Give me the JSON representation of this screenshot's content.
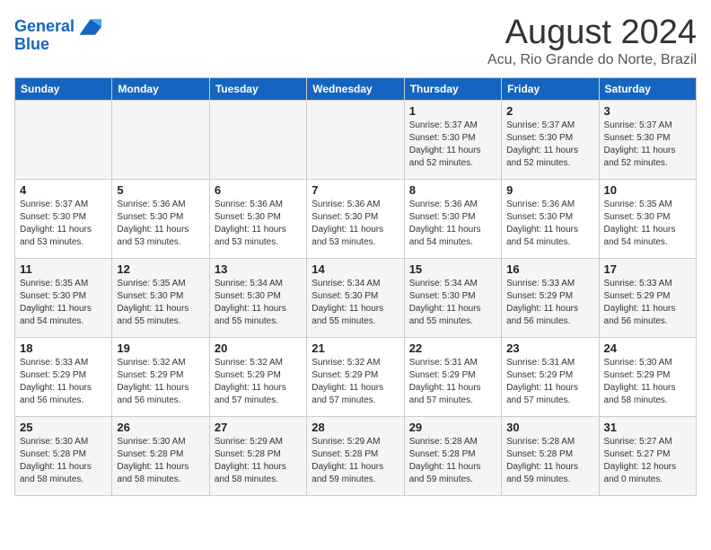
{
  "header": {
    "logo_line1": "General",
    "logo_line2": "Blue",
    "title": "August 2024",
    "subtitle": "Acu, Rio Grande do Norte, Brazil"
  },
  "days_of_week": [
    "Sunday",
    "Monday",
    "Tuesday",
    "Wednesday",
    "Thursday",
    "Friday",
    "Saturday"
  ],
  "weeks": [
    [
      {
        "day": "",
        "info": ""
      },
      {
        "day": "",
        "info": ""
      },
      {
        "day": "",
        "info": ""
      },
      {
        "day": "",
        "info": ""
      },
      {
        "day": "1",
        "info": "Sunrise: 5:37 AM\nSunset: 5:30 PM\nDaylight: 11 hours\nand 52 minutes."
      },
      {
        "day": "2",
        "info": "Sunrise: 5:37 AM\nSunset: 5:30 PM\nDaylight: 11 hours\nand 52 minutes."
      },
      {
        "day": "3",
        "info": "Sunrise: 5:37 AM\nSunset: 5:30 PM\nDaylight: 11 hours\nand 52 minutes."
      }
    ],
    [
      {
        "day": "4",
        "info": "Sunrise: 5:37 AM\nSunset: 5:30 PM\nDaylight: 11 hours\nand 53 minutes."
      },
      {
        "day": "5",
        "info": "Sunrise: 5:36 AM\nSunset: 5:30 PM\nDaylight: 11 hours\nand 53 minutes."
      },
      {
        "day": "6",
        "info": "Sunrise: 5:36 AM\nSunset: 5:30 PM\nDaylight: 11 hours\nand 53 minutes."
      },
      {
        "day": "7",
        "info": "Sunrise: 5:36 AM\nSunset: 5:30 PM\nDaylight: 11 hours\nand 53 minutes."
      },
      {
        "day": "8",
        "info": "Sunrise: 5:36 AM\nSunset: 5:30 PM\nDaylight: 11 hours\nand 54 minutes."
      },
      {
        "day": "9",
        "info": "Sunrise: 5:36 AM\nSunset: 5:30 PM\nDaylight: 11 hours\nand 54 minutes."
      },
      {
        "day": "10",
        "info": "Sunrise: 5:35 AM\nSunset: 5:30 PM\nDaylight: 11 hours\nand 54 minutes."
      }
    ],
    [
      {
        "day": "11",
        "info": "Sunrise: 5:35 AM\nSunset: 5:30 PM\nDaylight: 11 hours\nand 54 minutes."
      },
      {
        "day": "12",
        "info": "Sunrise: 5:35 AM\nSunset: 5:30 PM\nDaylight: 11 hours\nand 55 minutes."
      },
      {
        "day": "13",
        "info": "Sunrise: 5:34 AM\nSunset: 5:30 PM\nDaylight: 11 hours\nand 55 minutes."
      },
      {
        "day": "14",
        "info": "Sunrise: 5:34 AM\nSunset: 5:30 PM\nDaylight: 11 hours\nand 55 minutes."
      },
      {
        "day": "15",
        "info": "Sunrise: 5:34 AM\nSunset: 5:30 PM\nDaylight: 11 hours\nand 55 minutes."
      },
      {
        "day": "16",
        "info": "Sunrise: 5:33 AM\nSunset: 5:29 PM\nDaylight: 11 hours\nand 56 minutes."
      },
      {
        "day": "17",
        "info": "Sunrise: 5:33 AM\nSunset: 5:29 PM\nDaylight: 11 hours\nand 56 minutes."
      }
    ],
    [
      {
        "day": "18",
        "info": "Sunrise: 5:33 AM\nSunset: 5:29 PM\nDaylight: 11 hours\nand 56 minutes."
      },
      {
        "day": "19",
        "info": "Sunrise: 5:32 AM\nSunset: 5:29 PM\nDaylight: 11 hours\nand 56 minutes."
      },
      {
        "day": "20",
        "info": "Sunrise: 5:32 AM\nSunset: 5:29 PM\nDaylight: 11 hours\nand 57 minutes."
      },
      {
        "day": "21",
        "info": "Sunrise: 5:32 AM\nSunset: 5:29 PM\nDaylight: 11 hours\nand 57 minutes."
      },
      {
        "day": "22",
        "info": "Sunrise: 5:31 AM\nSunset: 5:29 PM\nDaylight: 11 hours\nand 57 minutes."
      },
      {
        "day": "23",
        "info": "Sunrise: 5:31 AM\nSunset: 5:29 PM\nDaylight: 11 hours\nand 57 minutes."
      },
      {
        "day": "24",
        "info": "Sunrise: 5:30 AM\nSunset: 5:29 PM\nDaylight: 11 hours\nand 58 minutes."
      }
    ],
    [
      {
        "day": "25",
        "info": "Sunrise: 5:30 AM\nSunset: 5:28 PM\nDaylight: 11 hours\nand 58 minutes."
      },
      {
        "day": "26",
        "info": "Sunrise: 5:30 AM\nSunset: 5:28 PM\nDaylight: 11 hours\nand 58 minutes."
      },
      {
        "day": "27",
        "info": "Sunrise: 5:29 AM\nSunset: 5:28 PM\nDaylight: 11 hours\nand 58 minutes."
      },
      {
        "day": "28",
        "info": "Sunrise: 5:29 AM\nSunset: 5:28 PM\nDaylight: 11 hours\nand 59 minutes."
      },
      {
        "day": "29",
        "info": "Sunrise: 5:28 AM\nSunset: 5:28 PM\nDaylight: 11 hours\nand 59 minutes."
      },
      {
        "day": "30",
        "info": "Sunrise: 5:28 AM\nSunset: 5:28 PM\nDaylight: 11 hours\nand 59 minutes."
      },
      {
        "day": "31",
        "info": "Sunrise: 5:27 AM\nSunset: 5:27 PM\nDaylight: 12 hours\nand 0 minutes."
      }
    ]
  ]
}
